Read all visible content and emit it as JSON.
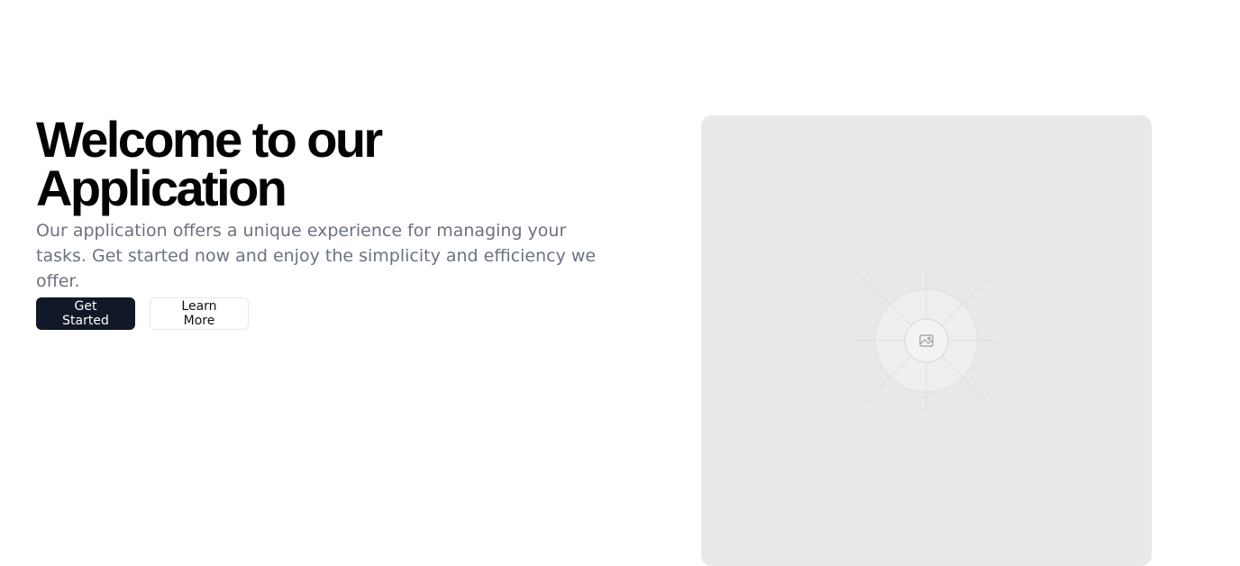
{
  "hero": {
    "title_line1": "Welcome to our",
    "title_line2": "Application",
    "subtitle": "Our application offers a unique experience for managing your tasks. Get started now and enjoy the simplicity and efficiency we offer.",
    "primary_button": "Get Started",
    "secondary_button": "Learn More"
  },
  "media": {
    "icon": "image-placeholder-icon",
    "background_color": "#e9e9e9"
  },
  "colors": {
    "primary_button_bg": "#111827",
    "subtitle_text": "#6b7280"
  }
}
